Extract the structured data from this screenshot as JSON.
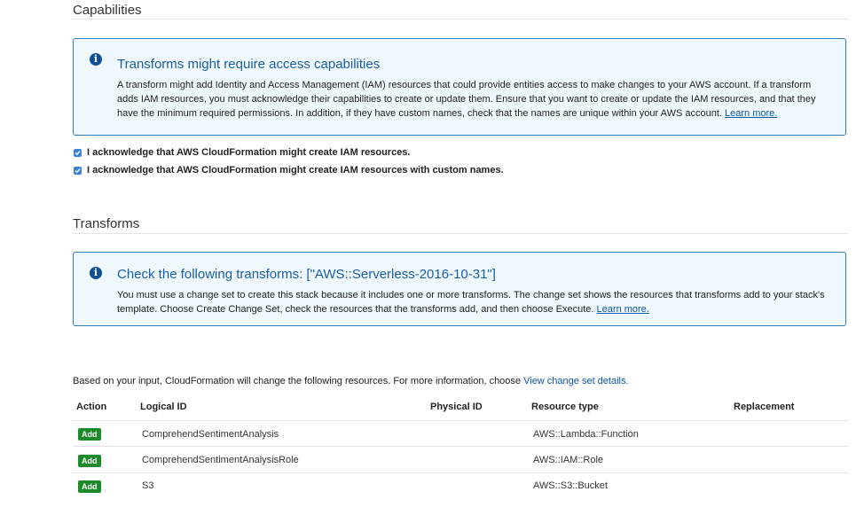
{
  "capabilities": {
    "title": "Capabilities",
    "info": {
      "heading": "Transforms might require access capabilities",
      "lines": [
        "A transform might add Identity and Access Management (IAM) resources that could provide entities access to make changes to your AWS account. If a transform",
        "adds IAM resources, you must acknowledge their capabilities to create or update them. Ensure that you want to create or update the IAM resources, and that they",
        "have the minimum required permissions. In addition, if they have custom names, check that the names are unique within your AWS account."
      ],
      "link": "Learn more."
    },
    "acknowledgements": [
      {
        "label": "I acknowledge that AWS CloudFormation might create IAM resources.",
        "checked": true
      },
      {
        "label": "I acknowledge that AWS CloudFormation might create IAM resources with custom names.",
        "checked": true
      }
    ]
  },
  "transforms": {
    "title": "Transforms",
    "info": {
      "heading": "Check the following transforms: [\"AWS::Serverless-2016-10-31\"]",
      "lines": [
        "You must use a change set to create this stack because it includes one or more transforms. The change set shows the resources that transforms add to your stack's",
        "template. Choose Create Change Set, check the resources that the transforms add, and then choose Execute."
      ],
      "link": "Learn more."
    }
  },
  "changes": {
    "intro": "Based on your input, CloudFormation will change the following resources. For more information, choose",
    "intro_link": "View change set details.",
    "columns": [
      "Action",
      "Logical ID",
      "Physical ID",
      "Resource type",
      "Replacement"
    ],
    "rows": [
      {
        "action": "Add",
        "logical_id": "ComprehendSentimentAnalysis",
        "physical_id": "",
        "resource_type": "AWS::Lambda::Function",
        "replacement": ""
      },
      {
        "action": "Add",
        "logical_id": "ComprehendSentimentAnalysisRole",
        "physical_id": "",
        "resource_type": "AWS::IAM::Role",
        "replacement": ""
      },
      {
        "action": "Add",
        "logical_id": "S3",
        "physical_id": "",
        "resource_type": "AWS::S3::Bucket",
        "replacement": ""
      }
    ]
  },
  "colors": {
    "info_border": "#2e7cb8",
    "info_background": "#eff8fd",
    "info_heading": "#1a5ea6",
    "link": "#0b56a8",
    "badge_green": "#1d8a29",
    "checkbox_blue": "#3b82d6"
  }
}
